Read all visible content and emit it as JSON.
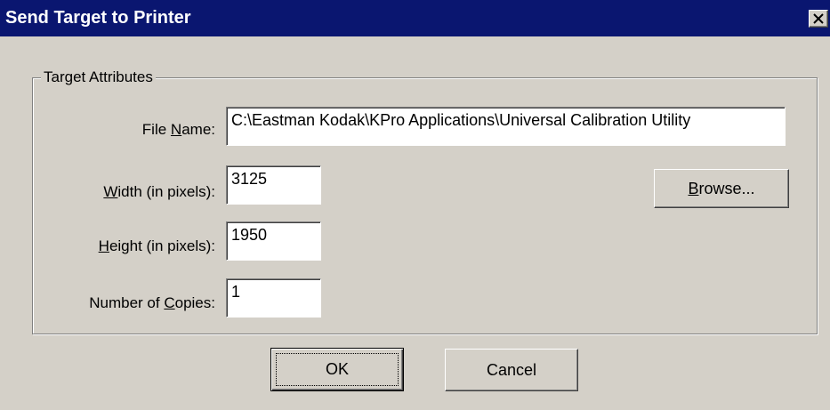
{
  "window": {
    "title": "Send Target to Printer",
    "title_bg": "#0a1670",
    "face_color": "#d4d0c8"
  },
  "titlebar": {
    "close_icon": "close-icon"
  },
  "group": {
    "legend": "Target Attributes"
  },
  "fields": {
    "file_name": {
      "label_pre": "File ",
      "label_accel": "N",
      "label_post": "ame:",
      "value": "C:\\Eastman Kodak\\KPro Applications\\Universal Calibration Utility"
    },
    "width": {
      "label_pre": "",
      "label_accel": "W",
      "label_post": "idth (in pixels):",
      "value": "3125"
    },
    "height": {
      "label_pre": "",
      "label_accel": "H",
      "label_post": "eight (in pixels):",
      "value": "1950"
    },
    "copies": {
      "label_pre": "Number of ",
      "label_accel": "C",
      "label_post": "opies:",
      "value": "1"
    }
  },
  "buttons": {
    "browse_accel": "B",
    "browse_rest": "rowse...",
    "ok": "OK",
    "cancel": "Cancel"
  }
}
